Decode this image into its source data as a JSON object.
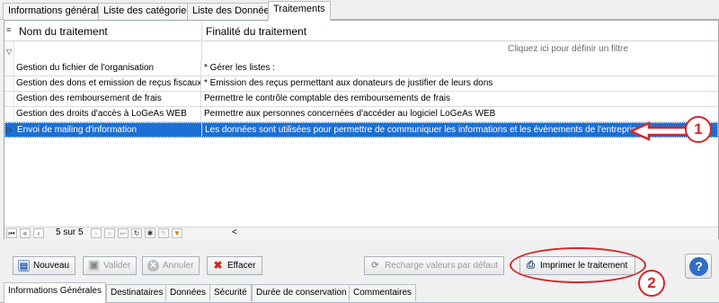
{
  "top_tabs": [
    {
      "label": "Informations générales"
    },
    {
      "label": "Liste des catégories"
    },
    {
      "label": "Liste des Données"
    },
    {
      "label": "Traitements"
    }
  ],
  "grid": {
    "columns": [
      "Nom du traitement",
      "Finalité du traitement"
    ],
    "filter_hint": "Cliquez ici pour définir un filtre",
    "rows": [
      {
        "name": "Gestion du fichier de l'organisation",
        "purpose": "* Gérer les listes :"
      },
      {
        "name": "Gestion des dons et emission de reçus fiscaux",
        "purpose": "* Emission des reçus permettant aux donateurs de justifier de leurs dons"
      },
      {
        "name": "Gestion des remboursement de frais",
        "purpose": "Permettre le contrôle comptable des remboursements de frais"
      },
      {
        "name": "Gestion des droits d'accès à LoGeAs WEB",
        "purpose": "Permettre aux personnes concernées d'accéder au logiciel LoGeAs WEB"
      },
      {
        "name": "Envoi de mailing d'information",
        "purpose": "Les données sont utilisées pour permettre de communiquer les informations et les évènements de l'entreprise."
      }
    ],
    "selected_row": 4
  },
  "navigator": {
    "record_text": "5 sur 5",
    "scroll_left": "<"
  },
  "toolbar": {
    "new_label": "Nouveau",
    "validate_label": "Valider",
    "cancel_label": "Annuler",
    "delete_label": "Effacer",
    "reload_label": "Recharge valeurs par défaut",
    "print_label": "Imprimer le traitement",
    "help_label": "?"
  },
  "bottom_tabs": [
    {
      "label": "Informations Générales"
    },
    {
      "label": "Destinataires"
    },
    {
      "label": "Données"
    },
    {
      "label": "Sécurité"
    },
    {
      "label": "Durée de conservation"
    },
    {
      "label": "Commentaires"
    }
  ],
  "annotations": {
    "callout_1": "1",
    "callout_2": "2",
    "color": "#d4262c"
  },
  "colors": {
    "selection": "#1c6fd4",
    "help": "#2f6fc6"
  }
}
